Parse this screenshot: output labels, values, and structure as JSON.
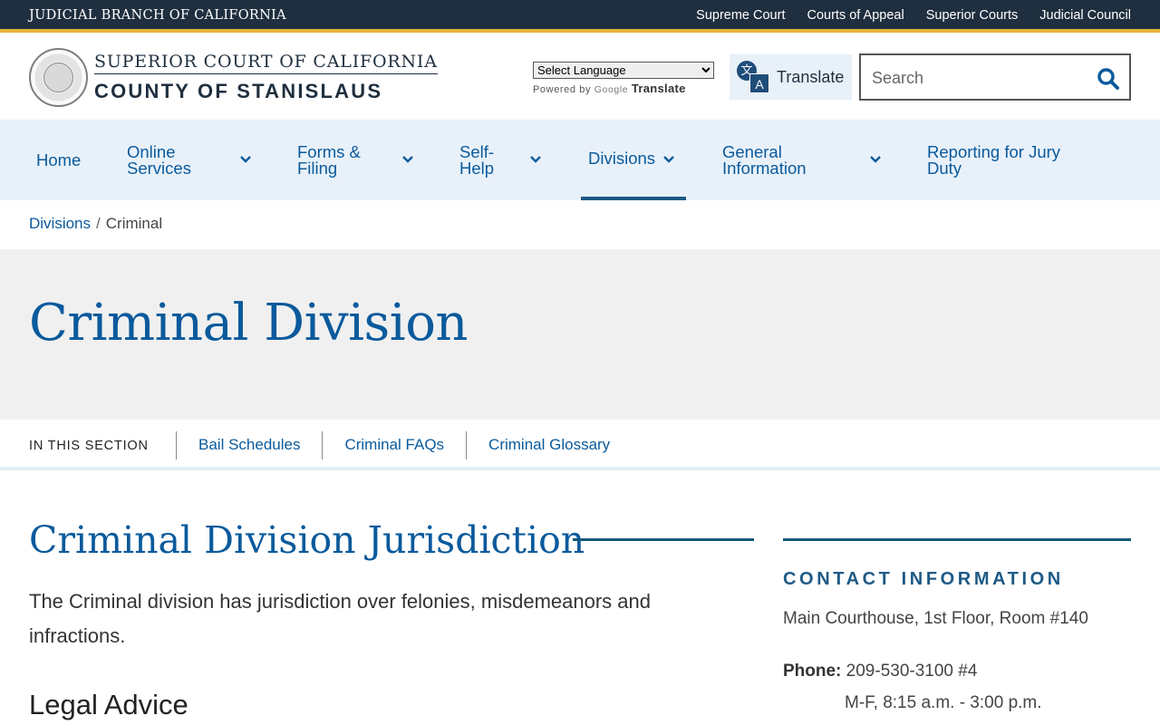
{
  "topbar": {
    "brand": "JUDICIAL BRANCH OF CALIFORNIA",
    "links": [
      "Supreme Court",
      "Courts of Appeal",
      "Superior Courts",
      "Judicial Council"
    ]
  },
  "header": {
    "court_line1": "SUPERIOR COURT OF CALIFORNIA",
    "court_line2": "COUNTY OF STANISLAUS",
    "language_select": "Select Language",
    "powered_by": "Powered by",
    "google": "Google",
    "translate_word": "Translate",
    "translate_button": "Translate",
    "search_placeholder": "Search"
  },
  "nav": {
    "items": [
      {
        "label": "Home"
      },
      {
        "label": "Online Services"
      },
      {
        "label": "Forms & Filing"
      },
      {
        "label": "Self-Help"
      },
      {
        "label": "Divisions"
      },
      {
        "label": "General Information"
      },
      {
        "label": "Reporting for Jury Duty"
      }
    ]
  },
  "breadcrumb": {
    "parent": "Divisions",
    "separator": "/",
    "current": "Criminal"
  },
  "hero": {
    "title": "Criminal Division"
  },
  "section_nav": {
    "label": "IN THIS SECTION",
    "links": [
      "Bail Schedules",
      "Criminal FAQs",
      "Criminal Glossary"
    ]
  },
  "main": {
    "title": "Criminal Division Jurisdiction",
    "intro": "The Criminal division has jurisdiction over felonies, misdemeanors and infractions.",
    "subheading": "Legal Advice"
  },
  "sidebar": {
    "title": "CONTACT INFORMATION",
    "location": "Main Courthouse, 1st Floor, Room #140",
    "phone_label": "Phone:",
    "phone": "209-530-3100 #4",
    "hours": "M-F, 8:15 a.m. - 3:00 p.m."
  },
  "colors": {
    "topbar_bg": "#1f2f3f",
    "accent_gold": "#e8b53a",
    "link_blue": "#0a5a9c",
    "nav_bg": "#e8f1fa",
    "hero_bg": "#f0f0f0"
  }
}
